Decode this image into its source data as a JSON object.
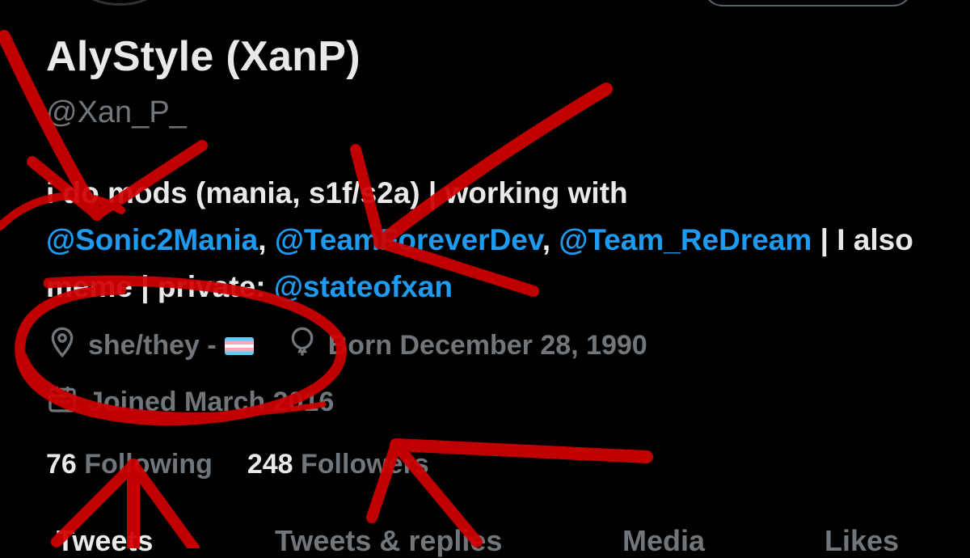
{
  "profile": {
    "display_name": "AlyStyle (XanP)",
    "handle": "@Xan_P_"
  },
  "bio": {
    "part1": "i do mods (mania, s1f/s2a) | working with",
    "mention1": "@Sonic2Mania",
    "sep1": ", ",
    "mention2": "@TeamForeverDev",
    "sep2": ", ",
    "mention3": "@Team_ReDream",
    "part2": " | I also meme | private: ",
    "mention4": "@stateofxan"
  },
  "meta": {
    "location": "she/they - ",
    "birthday": "Born December 28, 1990",
    "joined": "Joined March 2016",
    "location_icon": "location-pin-icon",
    "birthday_icon": "balloon-icon",
    "joined_icon": "calendar-icon"
  },
  "stats": {
    "following_count": "76",
    "following_label": "Following",
    "followers_count": "248",
    "followers_label": "Followers"
  },
  "tabs": [
    "Tweets",
    "Tweets & replies",
    "Media",
    "Likes"
  ],
  "colors": {
    "background": "#000000",
    "link": "#1d9bf0",
    "text": "#e7e9ea",
    "muted": "#71767b",
    "annotation": "#d10000"
  }
}
